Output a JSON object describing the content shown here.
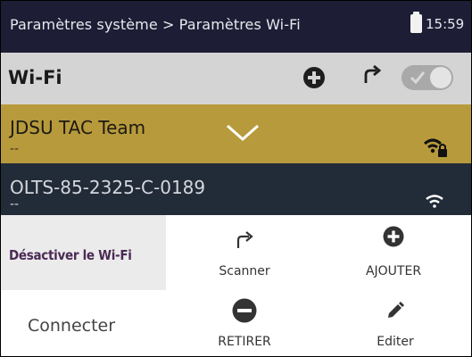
{
  "status_bar": {
    "breadcrumb": "Paramètres système > Paramètres Wi-Fi",
    "time": "15:59",
    "battery_icon": "battery-icon"
  },
  "header": {
    "title": "Wi-Fi",
    "add_icon": "add-circle-icon",
    "refresh_icon": "refresh-icon",
    "wifi_toggle": {
      "state": "on",
      "icon": "check-icon"
    }
  },
  "networks": [
    {
      "name": "JDSU TAC Team",
      "subtitle": "--",
      "selected": true,
      "secured": true,
      "icons": [
        "chevron-down-icon",
        "wifi-lock-icon"
      ]
    },
    {
      "name": "OLTS-85-2325-C-0189",
      "subtitle": "--",
      "selected": false,
      "secured": false,
      "icons": [
        "wifi-icon"
      ]
    }
  ],
  "menu": {
    "disable": "Désactiver le Wi-Fi",
    "connect": "Connecter",
    "scan": "Scanner",
    "add": "AJOUTER",
    "remove": "RETIRER",
    "edit": "Editer"
  },
  "colors": {
    "status_bar": "#1d1d35",
    "header": "#d4d4d4",
    "selected_network": "#b79a3b",
    "network": "#222b38",
    "disable_text": "#4a2a55"
  }
}
